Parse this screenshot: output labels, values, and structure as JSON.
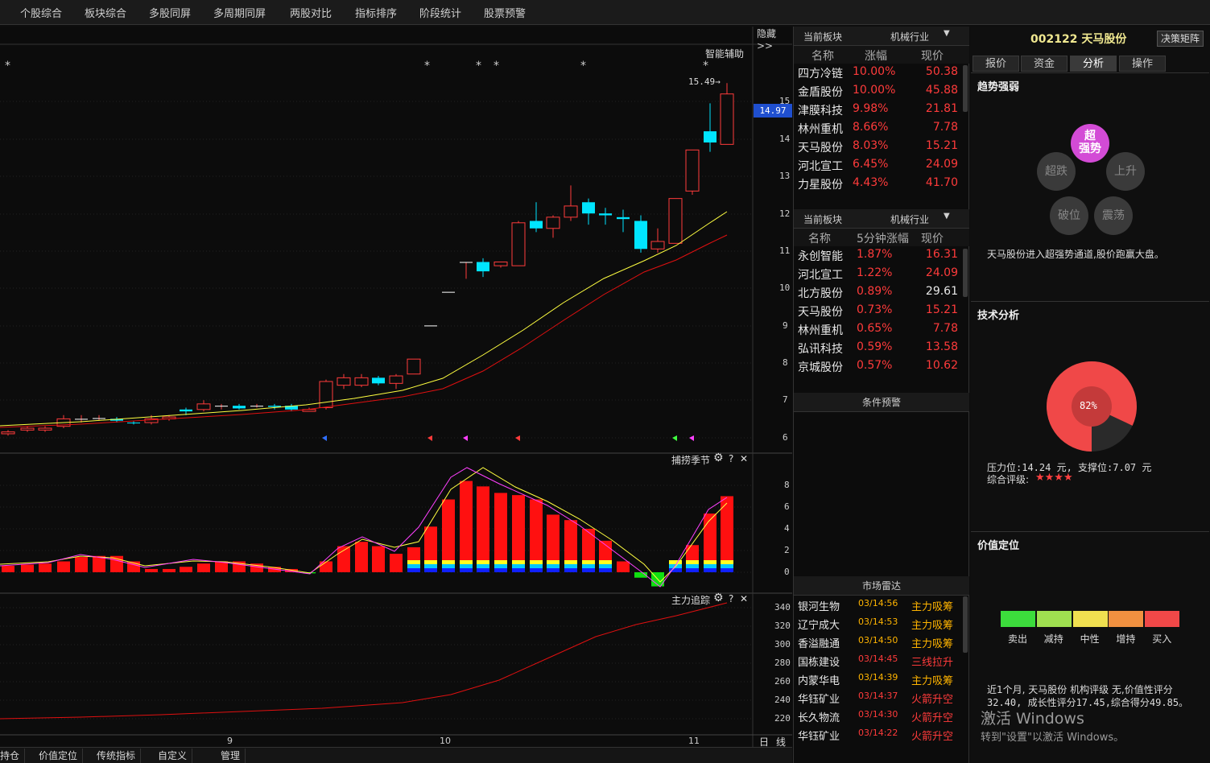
{
  "topmenu": [
    "个股综合",
    "板块综合",
    "多股同屏",
    "多周期同屏",
    "两股对比",
    "指标排序",
    "阶段统计",
    "股票预警"
  ],
  "chart": {
    "hide_label": "隐藏>>",
    "assist_label": "智能辅助",
    "peak_label": "15.49→",
    "current_price": "14.97",
    "yaxis_main": [
      "15",
      "14",
      "13",
      "12",
      "11",
      "10",
      "9",
      "8",
      "7",
      "6"
    ],
    "indicator1_name": "捕捞季节",
    "yaxis_ind1": [
      "8",
      "6",
      "4",
      "2",
      "0"
    ],
    "indicator2_name": "主力追踪",
    "yaxis_ind2": [
      "340",
      "320",
      "300",
      "280",
      "260",
      "240",
      "220"
    ],
    "xaxis": [
      "9",
      "10",
      "11"
    ],
    "period_labels": [
      "日",
      "线"
    ],
    "icon_gear": "gear-icon",
    "icon_help": "?",
    "icon_close": "✕",
    "colors": {
      "up": "#ff3b3b",
      "down": "#00e5ff",
      "ma5": "#ffff40",
      "ma10": "#e01010",
      "current_price_bg": "#1f4fcf"
    }
  },
  "bottomtabs": [
    "持仓",
    "价值定位",
    "传统指标",
    "自定义",
    "管理"
  ],
  "sector_panel": {
    "header_label": "当前板块",
    "sector_name": "机械行业",
    "cols": [
      "名称",
      "涨幅",
      "现价"
    ],
    "rows": [
      {
        "name": "四方冷链",
        "pct": "10.00%",
        "price": "50.38"
      },
      {
        "name": "金盾股份",
        "pct": "10.00%",
        "price": "45.88"
      },
      {
        "name": "津膜科技",
        "pct": "9.98%",
        "price": "21.81"
      },
      {
        "name": "林州重机",
        "pct": "8.66%",
        "price": "7.78"
      },
      {
        "name": "天马股份",
        "pct": "8.03%",
        "price": "15.21"
      },
      {
        "name": "河北宣工",
        "pct": "6.45%",
        "price": "24.09"
      },
      {
        "name": "力星股份",
        "pct": "4.43%",
        "price": "41.70"
      }
    ]
  },
  "sector_panel2": {
    "header_label": "当前板块",
    "sector_name": "机械行业",
    "cols": [
      "名称",
      "5分钟涨幅",
      "现价"
    ],
    "rows": [
      {
        "name": "永创智能",
        "pct": "1.87%",
        "price": "16.31",
        "price_color": "#ff3b3b"
      },
      {
        "name": "河北宣工",
        "pct": "1.22%",
        "price": "24.09",
        "price_color": "#ff3b3b"
      },
      {
        "name": "北方股份",
        "pct": "0.89%",
        "price": "29.61",
        "price_color": "#e8e8e8"
      },
      {
        "name": "天马股份",
        "pct": "0.73%",
        "price": "15.21",
        "price_color": "#ff3b3b"
      },
      {
        "name": "林州重机",
        "pct": "0.65%",
        "price": "7.78",
        "price_color": "#ff3b3b"
      },
      {
        "name": "弘讯科技",
        "pct": "0.59%",
        "price": "13.58",
        "price_color": "#ff3b3b"
      },
      {
        "name": "京城股份",
        "pct": "0.57%",
        "price": "10.62",
        "price_color": "#ff3b3b"
      }
    ]
  },
  "alert_panel": {
    "title": "条件预警"
  },
  "radar": {
    "title": "市场雷达",
    "rows": [
      {
        "name": "银河生物",
        "time": "03/14:56",
        "event": "主力吸筹",
        "color": "#ffb400"
      },
      {
        "name": "辽宁成大",
        "time": "03/14:53",
        "event": "主力吸筹",
        "color": "#ffb400"
      },
      {
        "name": "香溢融通",
        "time": "03/14:50",
        "event": "主力吸筹",
        "color": "#ffb400"
      },
      {
        "name": "国栋建设",
        "time": "03/14:45",
        "event": "三线拉升",
        "color": "#ff3b3b"
      },
      {
        "name": "内蒙华电",
        "time": "03/14:39",
        "event": "主力吸筹",
        "color": "#ffb400"
      },
      {
        "name": "华钰矿业",
        "time": "03/14:37",
        "event": "火箭升空",
        "color": "#ff3b3b"
      },
      {
        "name": "长久物流",
        "time": "03/14:30",
        "event": "火箭升空",
        "color": "#ff3b3b"
      },
      {
        "name": "华钰矿业",
        "time": "03/14:22",
        "event": "火箭升空",
        "color": "#ff3b3b"
      }
    ]
  },
  "stock": {
    "code_name": "002122 天马股份",
    "matrix_button": "决策矩阵",
    "tabs": [
      "报价",
      "资金",
      "分析",
      "操作"
    ],
    "active_tab": "分析"
  },
  "trend": {
    "title": "趋势强弱",
    "active": "超强势",
    "bubbles": {
      "top_line1": "超",
      "top_line2": "强势",
      "left": "超跌",
      "right": "上升",
      "bottom_left": "破位",
      "bottom_right": "震荡"
    },
    "comment": "天马股份进入超强势通道,股价跑赢大盘。"
  },
  "tech": {
    "title": "技术分析",
    "gauge_value": 0.82,
    "gauge_label": "82%",
    "pressure_line": "压力位:14.24 元, 支撑位:7.07 元",
    "rating_label": "综合评级:",
    "rating_stars": "★★★★"
  },
  "value": {
    "title": "价值定位",
    "scale": [
      "卖出",
      "减持",
      "中性",
      "增持",
      "买入"
    ],
    "scale_colors": [
      "#3cdc3c",
      "#9fe050",
      "#f0e050",
      "#f09040",
      "#f04848"
    ],
    "comment_line1": "近1个月, 天马股份 机构评级 无,价值性评分",
    "comment_line2": "32.40, 成长性评分17.45,综合得分49.85。"
  },
  "watermark": {
    "line1": "激活 Windows",
    "line2": "转到\"设置\"以激活 Windows。"
  }
}
